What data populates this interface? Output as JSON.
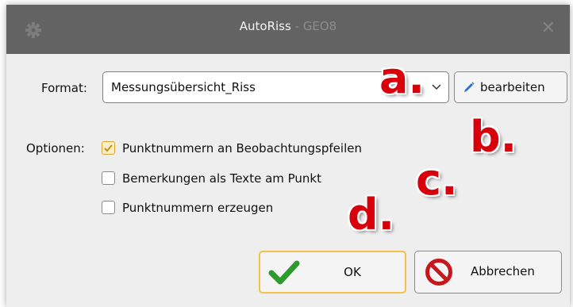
{
  "window": {
    "title": "AutoRiss",
    "title_suffix": " - GEO8",
    "close_glyph": "✕"
  },
  "format": {
    "label": "Format:",
    "selected_value": "Messungsübersicht_Riss",
    "edit_button_label": "bearbeiten"
  },
  "options": {
    "label": "Optionen:",
    "items": [
      {
        "label": "Punktnummern an Beobachtungspfeilen",
        "checked": true
      },
      {
        "label": "Bemerkungen als Texte am Punkt",
        "checked": false
      },
      {
        "label": "Punktnummern erzeugen",
        "checked": false
      }
    ]
  },
  "buttons": {
    "ok_label": "OK",
    "cancel_label": "Abbrechen"
  },
  "annotations": {
    "a": "a.",
    "b": "b.",
    "c": "c.",
    "d": "d."
  },
  "icons": {
    "title": "gear-icon",
    "dropdown": "chevron-down-icon",
    "edit": "pencil-icon",
    "ok": "checkmark-icon",
    "cancel": "prohibition-icon",
    "close": "close-icon"
  },
  "colors": {
    "titlebar": "#636363",
    "dialog_bg": "#eeeeee",
    "accent_check": "#d8a534",
    "ok_border": "#f2c24a",
    "ok_icon": "#2e9a2e",
    "cancel_icon": "#c8171b",
    "annotation": "#d8000a"
  }
}
